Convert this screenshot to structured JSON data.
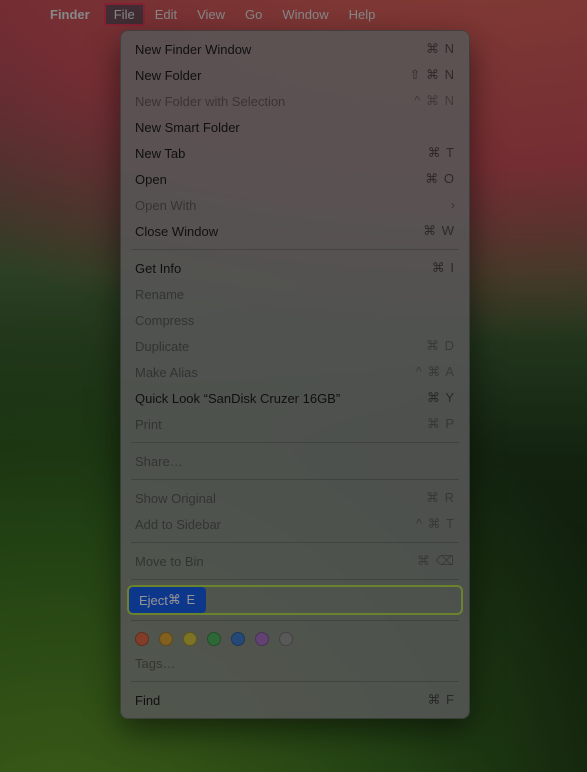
{
  "menubar": {
    "app": "Finder",
    "items": [
      {
        "label": "File",
        "active": true
      },
      {
        "label": "Edit",
        "active": false
      },
      {
        "label": "View",
        "active": false
      },
      {
        "label": "Go",
        "active": false
      },
      {
        "label": "Window",
        "active": false
      },
      {
        "label": "Help",
        "active": false
      }
    ]
  },
  "menu": {
    "sections": [
      [
        {
          "label": "New Finder Window",
          "shortcut": "⌘ N",
          "enabled": true
        },
        {
          "label": "New Folder",
          "shortcut": "⇧ ⌘ N",
          "enabled": true
        },
        {
          "label": "New Folder with Selection",
          "shortcut": "^ ⌘ N",
          "enabled": false
        },
        {
          "label": "New Smart Folder",
          "shortcut": "",
          "enabled": true
        },
        {
          "label": "New Tab",
          "shortcut": "⌘ T",
          "enabled": true
        },
        {
          "label": "Open",
          "shortcut": "⌘ O",
          "enabled": true
        },
        {
          "label": "Open With",
          "shortcut": "",
          "submenu": true,
          "enabled": false
        },
        {
          "label": "Close Window",
          "shortcut": "⌘ W",
          "enabled": true
        }
      ],
      [
        {
          "label": "Get Info",
          "shortcut": "⌘ I",
          "enabled": true
        },
        {
          "label": "Rename",
          "shortcut": "",
          "enabled": false
        },
        {
          "label": "Compress",
          "shortcut": "",
          "enabled": false
        },
        {
          "label": "Duplicate",
          "shortcut": "⌘ D",
          "enabled": false
        },
        {
          "label": "Make Alias",
          "shortcut": "^ ⌘ A",
          "enabled": false
        },
        {
          "label": "Quick Look “SanDisk Cruzer 16GB”",
          "shortcut": "⌘ Y",
          "enabled": true
        },
        {
          "label": "Print",
          "shortcut": "⌘ P",
          "enabled": false
        }
      ],
      [
        {
          "label": "Share…",
          "shortcut": "",
          "enabled": false
        }
      ],
      [
        {
          "label": "Show Original",
          "shortcut": "⌘ R",
          "enabled": false
        },
        {
          "label": "Add to Sidebar",
          "shortcut": "^ ⌘ T",
          "enabled": false
        }
      ],
      [
        {
          "label": "Move to Bin",
          "shortcut": "⌘ ⌫",
          "enabled": false
        }
      ],
      [
        {
          "label": "Eject",
          "shortcut": "⌘ E",
          "enabled": true,
          "selected": true
        }
      ],
      [
        {
          "tag_colors": [
            "#e06a46",
            "#dca436",
            "#d8c63e",
            "#4fb35d",
            "#3f7fd1",
            "#a773c6",
            "#9a9a9a"
          ]
        },
        {
          "label": "Tags…",
          "shortcut": "",
          "enabled": false
        }
      ],
      [
        {
          "label": "Find",
          "shortcut": "⌘ F",
          "enabled": true
        }
      ]
    ]
  }
}
